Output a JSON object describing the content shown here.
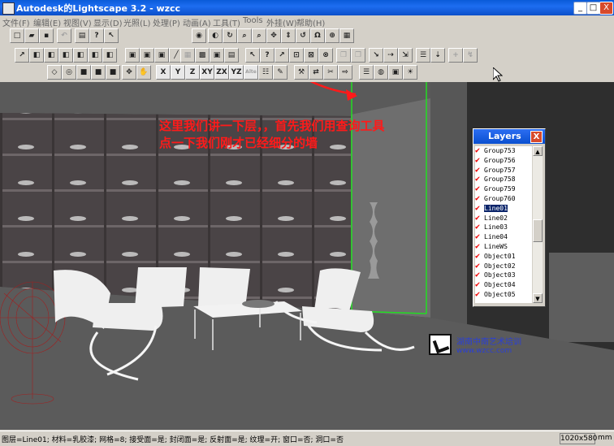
{
  "window": {
    "title": "Autodesk的Lightscape 3.2 - wzcc",
    "controls": [
      "_",
      "□",
      "X"
    ]
  },
  "menu": [
    "文件(F)",
    "编辑(E)",
    "视图(V)",
    "显示(D)",
    "光照(L)",
    "处理(P)",
    "动画(A)",
    "工具(T)",
    "Tools",
    "外挂(W)",
    "帮助(H)"
  ],
  "toolbar3": {
    "axes": [
      "X",
      "Y",
      "Z",
      "XY",
      "ZX",
      "YZ",
      "Alte"
    ]
  },
  "annotation": {
    "line1": "这里我们讲一下层，，首先我们用查询工具",
    "line2": "点一下我们刚才已经细分的墙"
  },
  "layers_panel": {
    "title": "Layers",
    "close": "X",
    "items": [
      {
        "name": "Group753",
        "checked": true
      },
      {
        "name": "Group756",
        "checked": true
      },
      {
        "name": "Group757",
        "checked": true
      },
      {
        "name": "Group758",
        "checked": true
      },
      {
        "name": "Group759",
        "checked": true
      },
      {
        "name": "Group760",
        "checked": true
      },
      {
        "name": "Line01",
        "checked": true,
        "selected": true
      },
      {
        "name": "Line02",
        "checked": true
      },
      {
        "name": "Line03",
        "checked": true
      },
      {
        "name": "Line04",
        "checked": true
      },
      {
        "name": "LineWS",
        "checked": true
      },
      {
        "name": "Object01",
        "checked": true
      },
      {
        "name": "Object02",
        "checked": true
      },
      {
        "name": "Object03",
        "checked": true
      },
      {
        "name": "Object04",
        "checked": true
      },
      {
        "name": "Object05",
        "checked": true
      }
    ]
  },
  "watermark": {
    "text": "湖南中南艺术培训",
    "url": "www.wzcc.com"
  },
  "status": {
    "text": "图层=Line01; 材料=乳胶漆; 网格=8; 接受面=是; 封闭面=是; 反射面=是; 纹理=开; 窗口=否; 洞口=否",
    "resolution": "1020x580",
    "unit": "mm"
  },
  "colors": {
    "title_bar": "#0a5bd8",
    "annotation": "#ff1a1a",
    "selection": "#0a246a",
    "highlight_wall": "#22dd22"
  }
}
